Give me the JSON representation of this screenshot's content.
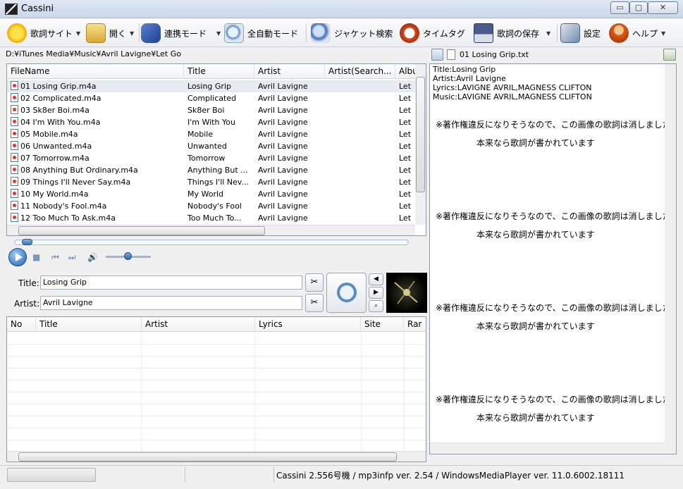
{
  "window": {
    "title": "Cassini",
    "min": "▭",
    "max": "▢",
    "close": "✕"
  },
  "toolbar": {
    "lyrics_site": "歌詞サイト",
    "open": "開く",
    "link_mode": "連携モード",
    "auto_mode": "全自動モード",
    "jacket_search": "ジャケット検索",
    "time_tag": "タイムタグ",
    "save_lyrics": "歌詞の保存",
    "settings": "設定",
    "help": "ヘルプ",
    "dropdown_glyph": "▼"
  },
  "path": "D:¥iTunes Media¥Music¥Avril Lavigne¥Let Go",
  "file_table": {
    "columns": [
      "FileName",
      "Title",
      "Artist",
      "Artist(Search...",
      "Albu"
    ],
    "rows": [
      {
        "file": "01 Losing Grip.m4a",
        "title": "Losing Grip",
        "artist": "Avril Lavigne",
        "album": "Let"
      },
      {
        "file": "02 Complicated.m4a",
        "title": "Complicated",
        "artist": "Avril Lavigne",
        "album": "Let"
      },
      {
        "file": "03 Sk8er Boi.m4a",
        "title": "Sk8er Boi",
        "artist": "Avril Lavigne",
        "album": "Let"
      },
      {
        "file": "04 I'm With You.m4a",
        "title": "I'm With You",
        "artist": "Avril Lavigne",
        "album": "Let"
      },
      {
        "file": "05 Mobile.m4a",
        "title": "Mobile",
        "artist": "Avril Lavigne",
        "album": "Let"
      },
      {
        "file": "06 Unwanted.m4a",
        "title": "Unwanted",
        "artist": "Avril Lavigne",
        "album": "Let"
      },
      {
        "file": "07 Tomorrow.m4a",
        "title": "Tomorrow",
        "artist": "Avril Lavigne",
        "album": "Let"
      },
      {
        "file": "08 Anything But Ordinary.m4a",
        "title": "Anything But ...",
        "artist": "Avril Lavigne",
        "album": "Let"
      },
      {
        "file": "09 Things I'll Never Say.m4a",
        "title": "Things I'll Nev...",
        "artist": "Avril Lavigne",
        "album": "Let"
      },
      {
        "file": "10 My World.m4a",
        "title": "My World",
        "artist": "Avril Lavigne",
        "album": "Let"
      },
      {
        "file": "11 Nobody's Fool.m4a",
        "title": "Nobody's Fool",
        "artist": "Avril Lavigne",
        "album": "Let"
      },
      {
        "file": "12 Too Much To Ask.m4a",
        "title": "Too Much To...",
        "artist": "Avril Lavigne",
        "album": "Let"
      }
    ]
  },
  "player": {
    "position_fraction": 0.02,
    "volume_fraction": 0.45
  },
  "search": {
    "title_label": "Title:",
    "title_value": "Losing Grip",
    "artist_label": "Artist:",
    "artist_value": "Avril Lavigne"
  },
  "result_table": {
    "columns": [
      "No",
      "Title",
      "Artist",
      "Lyrics",
      "Site",
      "Rar"
    ]
  },
  "lyrics": {
    "filename": "01 Losing Grip.txt",
    "header_lines": [
      "Title:Losing Grip",
      "Artist:Avril Lavigne",
      "Lyrics:LAVIGNE AVRIL,MAGNESS CLIFTON",
      "Music:LAVIGNE AVRIL,MAGNESS CLIFTON"
    ],
    "notice": "※著作権違反になりそうなので、この画像の歌詞は消しました",
    "notice2": "本来なら歌詞が書かれています"
  },
  "status": {
    "text": "Cassini 2.556号機 / mp3infp ver. 2.54 / WindowsMediaPlayer ver. 11.0.6002.18111"
  }
}
